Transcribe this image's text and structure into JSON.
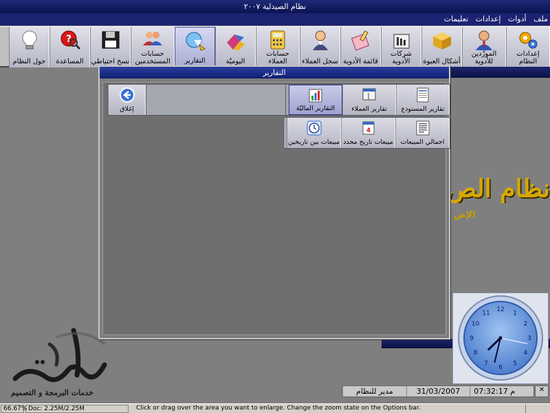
{
  "window": {
    "title": "نظام الصيدلية ٢٠٠٧"
  },
  "menu": [
    "ملف",
    "أدوات",
    "إعدادات",
    "تعليمات"
  ],
  "toolbar": [
    {
      "label": "إعدادات النظام",
      "icon": "gears-icon"
    },
    {
      "label": "الموزّدين للأدوية",
      "icon": "person-icon"
    },
    {
      "label": "أشكال العبوة",
      "icon": "box-icon"
    },
    {
      "label": "شركات الأدوية",
      "icon": "factory-icon"
    },
    {
      "label": "قائمة الأدوية",
      "icon": "medicine-list-icon"
    },
    {
      "label": "سجل العملاء",
      "icon": "customer-icon"
    },
    {
      "label": "حسابات العملاء",
      "icon": "calculator-icon"
    },
    {
      "label": "اليوميّة",
      "icon": "journal-icon"
    },
    {
      "label": "التقارير",
      "icon": "reports-icon",
      "active": true
    },
    {
      "label": "حسابات المستخدمين",
      "icon": "users-icon"
    },
    {
      "label": "نسخ احتياطي",
      "icon": "floppy-icon"
    },
    {
      "label": "المساعدة",
      "icon": "help-icon"
    },
    {
      "label": "حول النظام",
      "icon": "bulb-icon"
    }
  ],
  "background": {
    "system_title": "نظام الص",
    "system_subtitle": "الإص"
  },
  "dialog": {
    "title": "التقارير",
    "row1": [
      {
        "label": "تقارير المستودع",
        "icon": "warehouse-report-icon"
      },
      {
        "label": "تقارير العملاء",
        "icon": "customers-report-icon"
      },
      {
        "label": "التقارير الماليّة",
        "icon": "financial-report-icon",
        "selected": true
      }
    ],
    "row2": [
      {
        "label": "اجمالي المبيعات",
        "icon": "total-sales-icon"
      },
      {
        "label": "مبيعات تاريخ محدد",
        "icon": "date-sales-icon"
      },
      {
        "label": "مبيعات بين تاريخين",
        "icon": "range-sales-icon"
      }
    ],
    "close": {
      "label": "إغلاق",
      "icon": "back-arrow-icon"
    }
  },
  "status": {
    "time": "07:32:17",
    "time_suffix": "م",
    "date": "31/03/2007",
    "user": "مدير للنظام"
  },
  "clock": {
    "hours": 7,
    "minutes": 32,
    "seconds": 17
  },
  "logo": {
    "caption": "خدمات البرمجة و التصميم"
  },
  "viewer": {
    "zoom": "66.67%",
    "doc": "Doc: 2.25M/2.25M",
    "hint": "Click or drag over the area you want to enlarge. Change the zoom state on the Options bar."
  }
}
